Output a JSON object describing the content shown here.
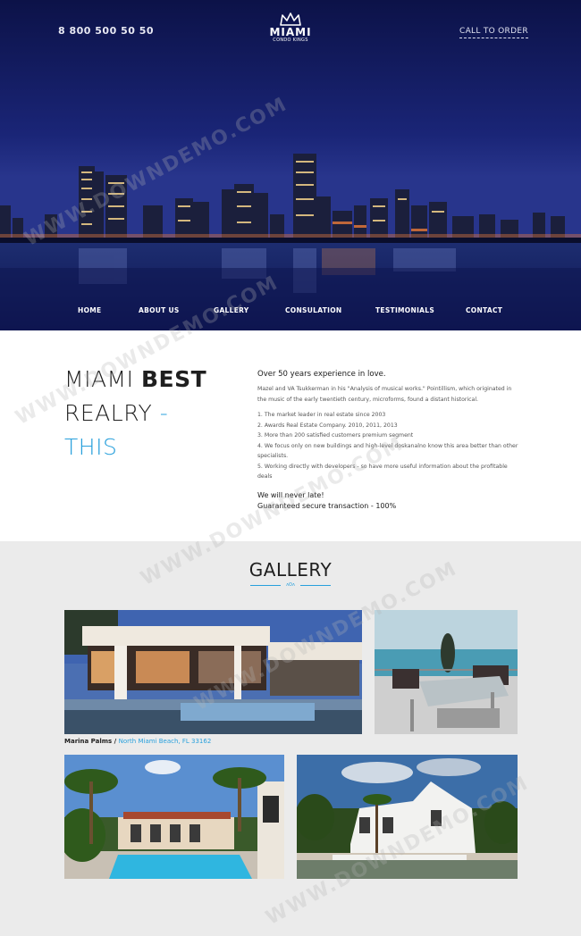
{
  "header": {
    "phone": "8 800 500 50 50",
    "logo": {
      "name": "MIAMI",
      "sub": "CONDO KINGS"
    },
    "cta": "CALL TO ORDER"
  },
  "nav": {
    "items": [
      "HOME",
      "ABOUT US",
      "GALLERY",
      "CONSULATION",
      "TESTIMONIALS",
      "CONTACT"
    ]
  },
  "about": {
    "headline_1": "MIAMI",
    "headline_1_bold": "BEST",
    "headline_2": "REALRY",
    "headline_2_dash": "-",
    "headline_3": "THIS",
    "heading": "Over 50 years experience in love.",
    "intro": "Mazel and VA Tsukkerman in his \"Analysis of musical works.\" Pointillism, which originated in the music of the early twentieth century, microforms, found a distant historical.",
    "points": [
      "1. The market leader in real estate since 2003",
      "2. Awards Real Estate Company. 2010, 2011, 2013",
      "3. More than 200 satisfied customers premium segment",
      "4. We focus only on new buildings and high-level doskanalno know this area better than other specialists.",
      "5. Working directly with developers - so have more useful information about the profitable deals"
    ],
    "late_1": "We will never late!",
    "late_2": "Guaranteed secure transaction - 100%"
  },
  "gallery": {
    "title": "GALLERY",
    "mark": "ʌʘʌ",
    "caption_name": "Marina Palms /",
    "caption_location": "North Miami Beach, FL 33162"
  },
  "watermark": "WWW.DOWNDEMO.COM",
  "colors": {
    "accent": "#28a0dc",
    "hero_bg": "#141c60"
  }
}
